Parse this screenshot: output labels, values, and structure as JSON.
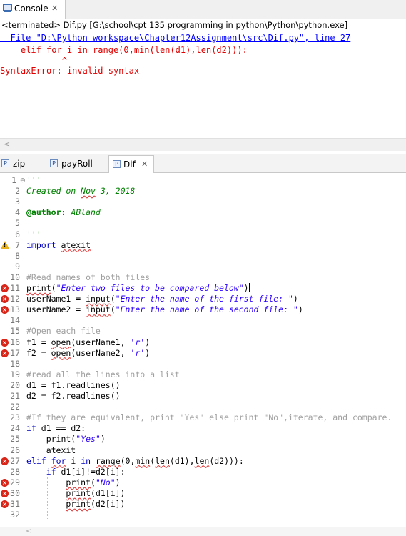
{
  "console": {
    "tab_label": "Console",
    "tab_close": "✕",
    "status": "<terminated> Dif.py [G:\\school\\cpt 135 programming in python\\Python\\python.exe]",
    "traceback": {
      "file_line": "  File \"D:\\Python workspace\\Chapter12Assignment\\src\\Dif.py\", line 27",
      "code_line": "    elif for i in range(0,min(len(d1),len(d2))):",
      "caret_line": "            ^",
      "error_line": "SyntaxError: invalid syntax"
    },
    "scroll_left": "<"
  },
  "editor_tabs": [
    {
      "label": "zip",
      "icon": "python-file-icon"
    },
    {
      "label": "payRoll",
      "icon": "python-file-icon"
    },
    {
      "label": "Dif",
      "icon": "python-file-icon",
      "close": "✕",
      "active": true
    }
  ],
  "code": {
    "lines": [
      {
        "n": "1",
        "text": "'''"
      },
      {
        "n": "2",
        "text": "Created on Nov 3, 2018"
      },
      {
        "n": "3",
        "text": ""
      },
      {
        "n": "4",
        "text": "@author: ABland"
      },
      {
        "n": "5",
        "text": ""
      },
      {
        "n": "6",
        "text": "'''"
      },
      {
        "n": "7",
        "text": "import atexit"
      },
      {
        "n": "8",
        "text": ""
      },
      {
        "n": "9",
        "text": ""
      },
      {
        "n": "10",
        "text": "#Read names of both files"
      },
      {
        "n": "11",
        "text": "print(\"Enter two files to be compared below\")"
      },
      {
        "n": "12",
        "text": "userName1 = input(\"Enter the name of the first file: \")"
      },
      {
        "n": "13",
        "text": "userName2 = input(\"Enter the name of the second file: \")"
      },
      {
        "n": "14",
        "text": ""
      },
      {
        "n": "15",
        "text": "#Open each file"
      },
      {
        "n": "16",
        "text": "f1 = open(userName1, 'r')"
      },
      {
        "n": "17",
        "text": "f2 = open(userName2, 'r')"
      },
      {
        "n": "18",
        "text": ""
      },
      {
        "n": "19",
        "text": "#read all the lines into a list"
      },
      {
        "n": "20",
        "text": "d1 = f1.readlines()"
      },
      {
        "n": "21",
        "text": "d2 = f2.readlines()"
      },
      {
        "n": "22",
        "text": ""
      },
      {
        "n": "23",
        "text": "#If they are equivalent, print \"Yes\" else print \"No\",iterate, and compare."
      },
      {
        "n": "24",
        "text": "if d1 == d2:"
      },
      {
        "n": "25",
        "text": "    print(\"Yes\")"
      },
      {
        "n": "26",
        "text": "    atexit"
      },
      {
        "n": "27",
        "text": "elif for i in range(0,min(len(d1),len(d2))):"
      },
      {
        "n": "28",
        "text": "    if d1[i]!=d2[i]:"
      },
      {
        "n": "29",
        "text": "        print(\"No\")"
      },
      {
        "n": "30",
        "text": "        print(d1[i])"
      },
      {
        "n": "31",
        "text": "        print(d2[i])"
      },
      {
        "n": "32",
        "text": ""
      }
    ],
    "error_lines": [
      "11",
      "12",
      "13",
      "16",
      "17",
      "27",
      "29",
      "30",
      "31"
    ],
    "warning_lines": [
      "7"
    ]
  },
  "colors": {
    "keyword": "#0000c0",
    "string": "#2a00ff",
    "comment": "#a0a0a0",
    "docstring": "#008000",
    "error": "#d8271a",
    "console_error": "#e00000",
    "console_link": "#0000ff"
  },
  "editor_scroll_left": "<"
}
